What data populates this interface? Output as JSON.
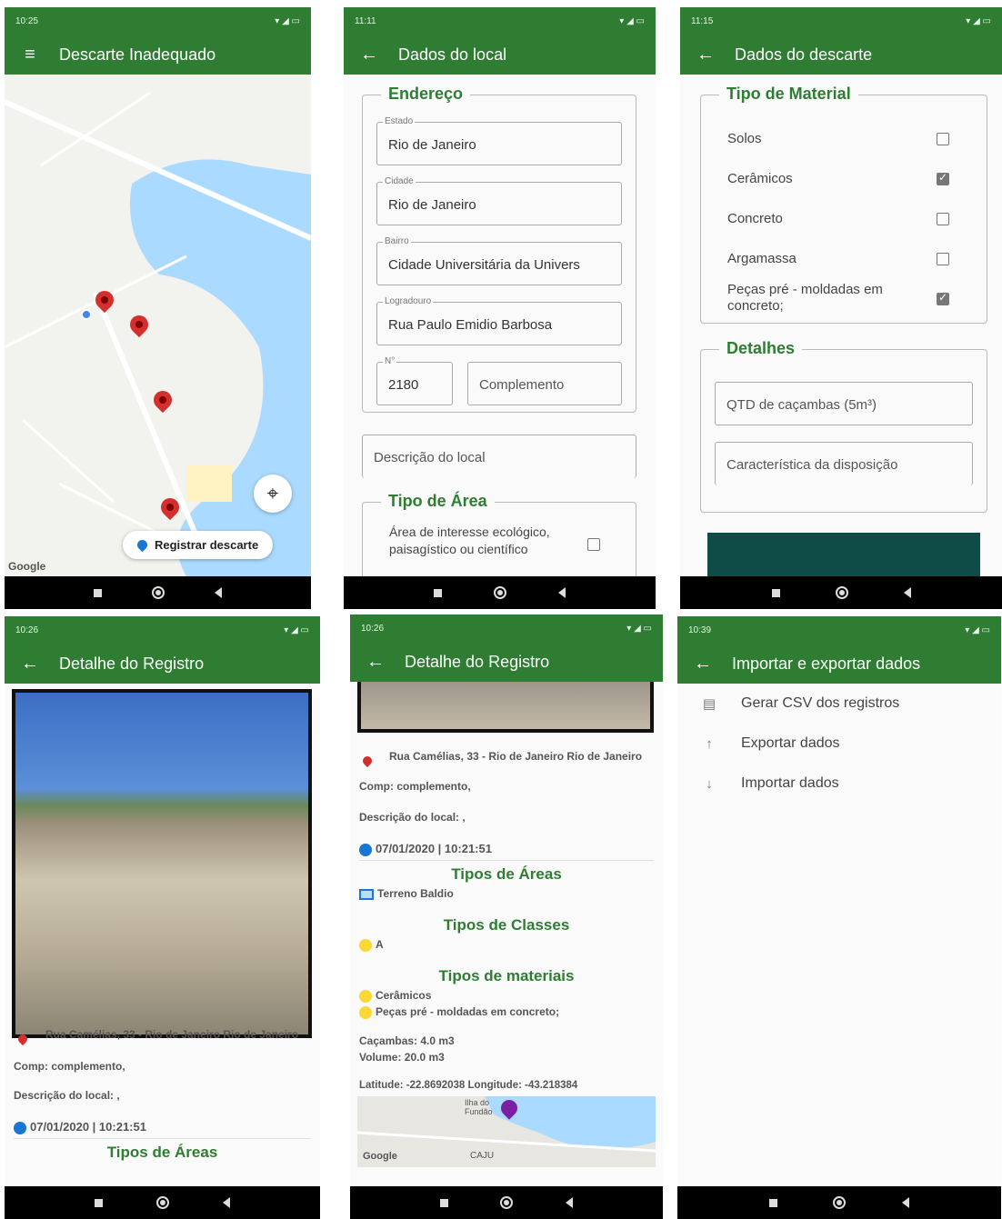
{
  "screens": {
    "map": {
      "status_time": "10:25",
      "title": "Descarte Inadequado",
      "register_button": "Registrar descarte",
      "google": "Google"
    },
    "local": {
      "status_time": "11:11",
      "title": "Dados do local",
      "address_legend": "Endereço",
      "fields": [
        {
          "label": "Estado",
          "value": "Rio de Janeiro"
        },
        {
          "label": "Cidade",
          "value": "Rio de Janeiro"
        },
        {
          "label": "Bairro",
          "value": "Cidade Universitária da Univers"
        },
        {
          "label": "Logradouro",
          "value": "Rua Paulo Emidio Barbosa"
        }
      ],
      "number_label": "N°",
      "number_value": "2180",
      "complement_placeholder": "Complemento",
      "description_placeholder": "Descrição do local",
      "area_legend": "Tipo de Área",
      "area_option": "Área de interesse ecológico, paisagístico ou científico"
    },
    "descarte": {
      "status_time": "11:15",
      "title": "Dados do descarte",
      "material_legend": "Tipo de Material",
      "materials": [
        {
          "label": "Solos",
          "checked": false
        },
        {
          "label": "Cerâmicos",
          "checked": true
        },
        {
          "label": "Concreto",
          "checked": false
        },
        {
          "label": "Argamassa",
          "checked": false
        },
        {
          "label": "Peças pré - moldadas em concreto;",
          "checked": true
        }
      ],
      "details_legend": "Detalhes",
      "qtd_placeholder": "QTD de caçambas (5m³)",
      "caracteristica_placeholder": "Característica da disposição"
    },
    "detalhe1": {
      "status_time": "10:26",
      "title": "Detalhe do Registro",
      "address": "Rua Camélias, 33 - Rio de Janeiro Rio de Janeiro",
      "complement": "Comp: complemento,",
      "description": "Descrição do local: ,",
      "datetime": "07/01/2020 | 10:21:51",
      "areas_title": "Tipos de Áreas"
    },
    "detalhe2": {
      "status_time": "10:26",
      "title": "Detalhe do Registro",
      "address": "Rua Camélias, 33 - Rio de Janeiro Rio de Janeiro",
      "complement": "Comp: complemento,",
      "description": "Descrição do local: ,",
      "datetime": "07/01/2020 | 10:21:51",
      "areas_title": "Tipos de Áreas",
      "area_value": "Terreno Baldio",
      "classes_title": "Tipos de Classes",
      "class_value": "A",
      "materials_title": "Tipos de materiais",
      "material_values": [
        "Cerâmicos",
        "Peças pré - moldadas em concreto;"
      ],
      "cacambas": "Caçambas: 4.0  m3",
      "volume": "Volume: 20.0  m3",
      "latlong": "Latitude: -22.8692038  Longitude: -43.218384",
      "map_label_1": "Ilha do Fundão",
      "map_label_2": "CAJU",
      "google": "Google"
    },
    "importexport": {
      "status_time": "10:39",
      "title": "Importar e exportar dados",
      "items": [
        {
          "label": "Gerar CSV dos registros",
          "icon": "table-icon"
        },
        {
          "label": "Exportar dados",
          "icon": "arrow-up-icon"
        },
        {
          "label": "Importar dados",
          "icon": "arrow-down-icon"
        }
      ]
    }
  },
  "colors": {
    "primary": "#2e7d32",
    "pin": "#d32f2f",
    "accent_blue": "#1976d2"
  }
}
